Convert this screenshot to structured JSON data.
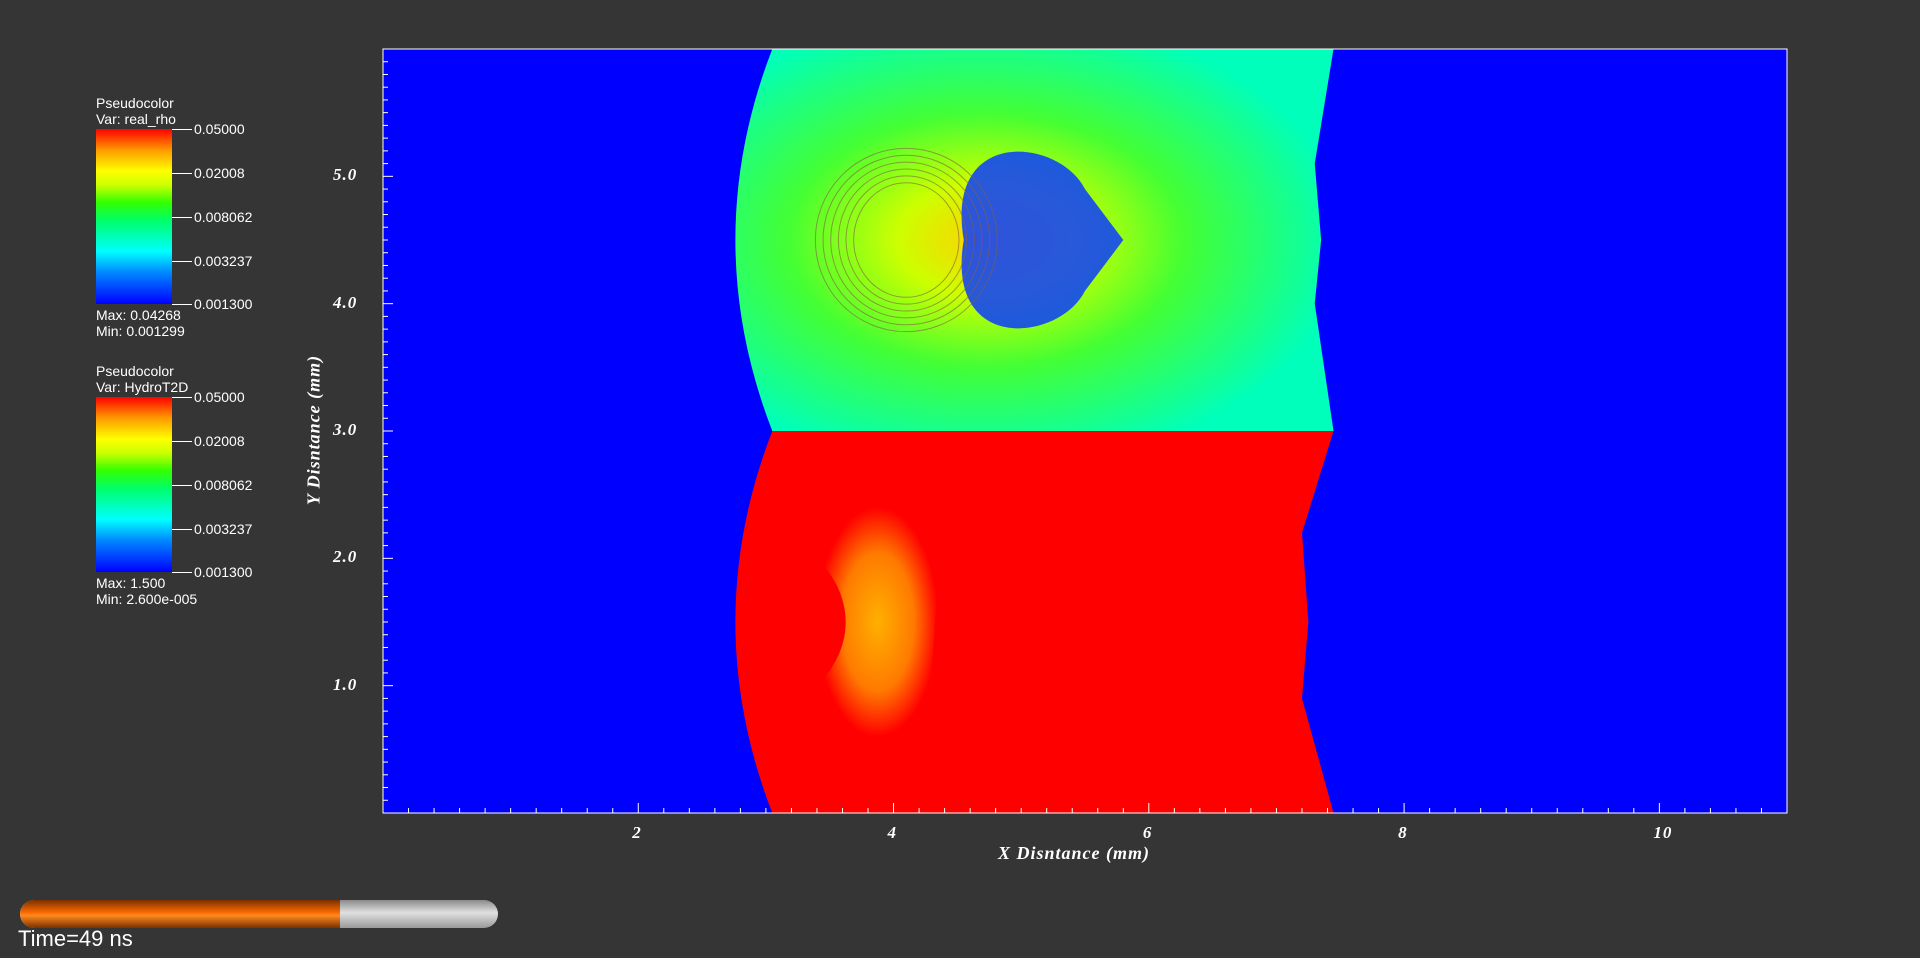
{
  "legends": [
    {
      "plot_type": "Pseudocolor",
      "var": "Var: real_rho",
      "ticks": [
        "0.05000",
        "0.02008",
        "0.008062",
        "0.003237",
        "0.001300"
      ],
      "max": "Max:  0.04268",
      "min": "Min:  0.001299"
    },
    {
      "plot_type": "Pseudocolor",
      "var": "Var: HydroT2D",
      "ticks": [
        "0.05000",
        "0.02008",
        "0.008062",
        "0.003237",
        "0.001300"
      ],
      "max": "Max:  1.500",
      "min": "Min:  2.600e-005"
    }
  ],
  "chart_data": {
    "type": "heatmap",
    "xlabel": "X Disntance (mm)",
    "ylabel": "Y Disntance (mm)",
    "xlim": [
      0,
      11
    ],
    "ylim": [
      0,
      6
    ],
    "x_ticks": [
      "2",
      "4",
      "6",
      "8",
      "10"
    ],
    "y_ticks": [
      "1.0",
      "2.0",
      "3.0",
      "4.0",
      "5.0"
    ],
    "x_tick_values": [
      2,
      4,
      6,
      8,
      10
    ],
    "y_tick_values": [
      1,
      2,
      3,
      4,
      5
    ],
    "background_color": "#0000ff",
    "upper_region": {
      "variable": "real_rho",
      "y_range": [
        3,
        6
      ],
      "shock_left_x": 2.55,
      "front_right_x": 7.4,
      "fill": "#00ff88"
    },
    "lower_region": {
      "variable": "HydroT2D",
      "y_range": [
        0,
        3
      ],
      "shock_left_x": 2.55,
      "front_right_x": 7.4,
      "fill": "#ff0000"
    }
  },
  "progress": {
    "fraction": 0.67
  },
  "time_label": "Time=49 ns",
  "colors": {
    "accent": "#ff6a00",
    "background": "#353535"
  }
}
